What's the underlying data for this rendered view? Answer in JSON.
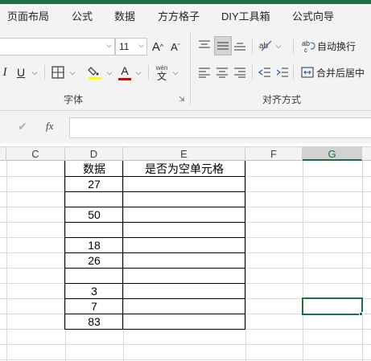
{
  "menu": [
    "页面布局",
    "公式",
    "数据",
    "方方格子",
    "DIY工具箱",
    "公式向导"
  ],
  "ribbon": {
    "font_size": "11",
    "font_group_label": "字体",
    "align_group_label": "对齐方式",
    "wrap_text_label": "自动换行",
    "merge_center_label": "合并后居中",
    "italic": "I",
    "underline": "U",
    "phonetic_top": "wén",
    "phonetic_bottom": "文",
    "font_color": "A",
    "grow_font": "A^",
    "shrink_font": "Aˇ"
  },
  "formula_bar": {
    "fx": "fx",
    "value": ""
  },
  "columns": [
    "C",
    "D",
    "E",
    "F",
    "G"
  ],
  "selected_column": "G",
  "table": {
    "header": [
      "数据",
      "是否为空单元格"
    ],
    "values": [
      "27",
      "",
      "50",
      "",
      "18",
      "26",
      "",
      "3",
      "7",
      "83"
    ]
  },
  "colors": {
    "accent": "#1e6e42",
    "font_color_bar": "#e00000",
    "highlight_bar": "#ffff00"
  }
}
